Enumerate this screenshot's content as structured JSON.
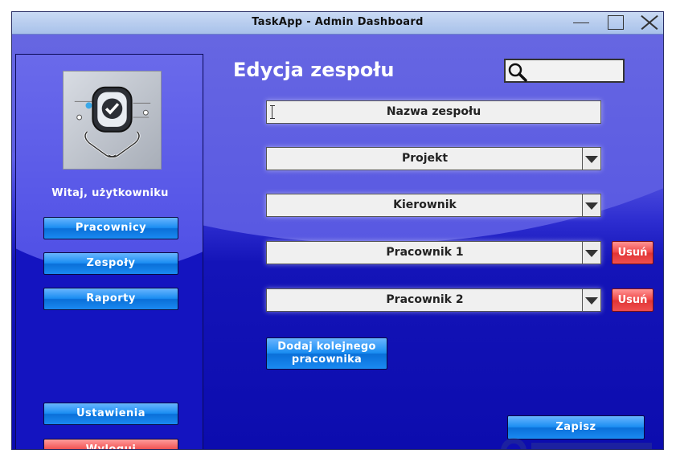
{
  "window": {
    "title": "TaskApp - Admin Dashboard"
  },
  "sidebar": {
    "welcome": "Witaj, użytkowniku",
    "nav": [
      {
        "label": "Pracownicy"
      },
      {
        "label": "Zespoły"
      },
      {
        "label": "Raporty"
      }
    ],
    "settings_label": "Ustawienia",
    "logout_label": "Wyloguj"
  },
  "main": {
    "heading": "Edycja zespołu",
    "search": {
      "placeholder": "",
      "value": ""
    },
    "team_name": {
      "placeholder": "Nazwa zespołu"
    },
    "project": {
      "selected": "Projekt"
    },
    "manager": {
      "selected": "Kierownik"
    },
    "employees": [
      {
        "selected": "Pracownik 1",
        "remove_label": "Usuń"
      },
      {
        "selected": "Pracownik 2",
        "remove_label": "Usuń"
      }
    ],
    "add_employee_line1": "Dodaj kolejnego",
    "add_employee_line2": "pracownika",
    "save_label": "Zapisz"
  },
  "colors": {
    "primary_button": "#1a8df2",
    "danger_button": "#f04848",
    "background": "#1414b8"
  }
}
